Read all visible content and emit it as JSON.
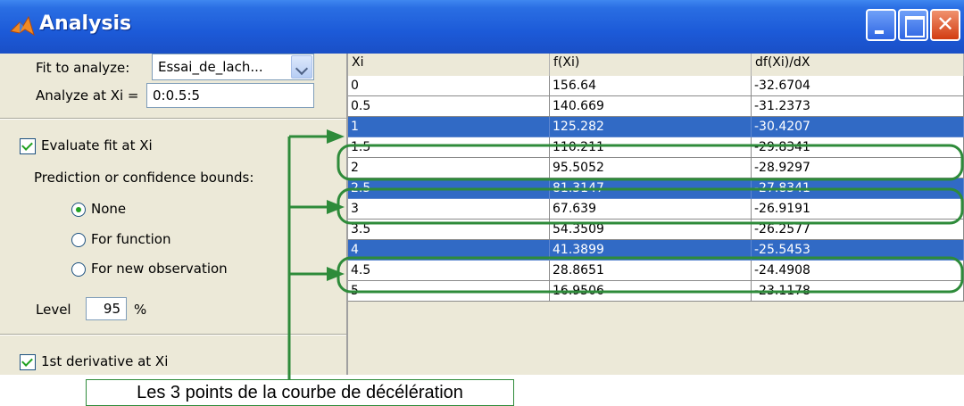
{
  "window": {
    "title": "Analysis",
    "controls": [
      "minimize",
      "maximize",
      "close"
    ]
  },
  "left_panel": {
    "fit_label": "Fit to analyze:",
    "fit_value": "Essai_de_lach...",
    "xi_label": "Analyze at Xi =",
    "xi_value": "0:0.5:5",
    "evaluate_label": "Evaluate fit at Xi",
    "evaluate_checked": true,
    "bounds_label": "Prediction or confidence bounds:",
    "radio_options": [
      {
        "label": "None",
        "selected": true
      },
      {
        "label": "For function",
        "selected": false
      },
      {
        "label": "For new observation",
        "selected": false
      }
    ],
    "level_label": "Level",
    "level_value": "95",
    "level_unit": "%",
    "derivative_label": "1st derivative at Xi",
    "derivative_checked": true
  },
  "table": {
    "headers": [
      "Xi",
      "f(Xi)",
      "df(Xi)/dX"
    ],
    "rows": [
      {
        "xi": "0",
        "f": "156.64",
        "df": "-32.6704",
        "selected": false
      },
      {
        "xi": "0.5",
        "f": "140.669",
        "df": "-31.2373",
        "selected": false
      },
      {
        "xi": "1",
        "f": "125.282",
        "df": "-30.4207",
        "selected": true
      },
      {
        "xi": "1.5",
        "f": "110.211",
        "df": "-29.8341",
        "selected": false
      },
      {
        "xi": "2",
        "f": "95.5052",
        "df": "-28.9297",
        "selected": false
      },
      {
        "xi": "2.5",
        "f": "81.3147",
        "df": "-27.8341",
        "selected": true
      },
      {
        "xi": "3",
        "f": "67.639",
        "df": "-26.9191",
        "selected": false
      },
      {
        "xi": "3.5",
        "f": "54.3509",
        "df": "-26.2577",
        "selected": false
      },
      {
        "xi": "4",
        "f": "41.3899",
        "df": "-25.5453",
        "selected": true
      },
      {
        "xi": "4.5",
        "f": "28.8651",
        "df": "-24.4908",
        "selected": false
      },
      {
        "xi": "5",
        "f": "16.9506",
        "df": "-23.1178",
        "selected": false
      }
    ]
  },
  "annotation": {
    "caption": "Les 3 points de la courbe de décélération",
    "color": "#2e8b3a"
  },
  "colors": {
    "titlebar": "#1c5ad8",
    "selection": "#316ac5",
    "checkmark": "#21a121"
  }
}
